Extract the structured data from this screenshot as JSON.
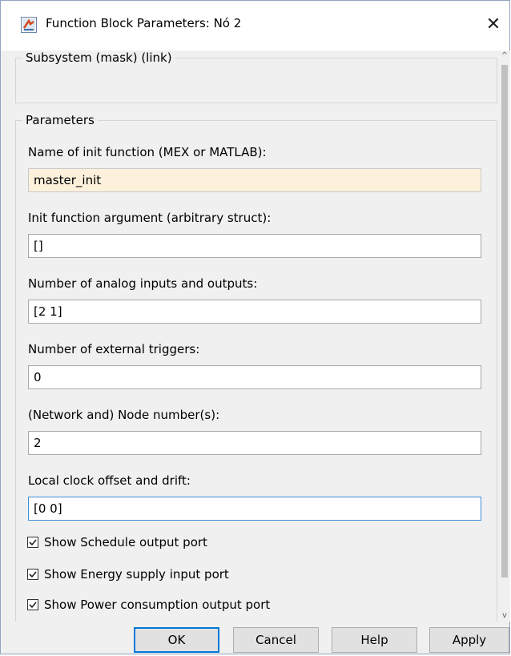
{
  "window": {
    "title": "Function Block Parameters: Nó 2",
    "close_symbol": "✕",
    "icon": "simulink-block-icon"
  },
  "subsystem": {
    "legend": "Subsystem (mask) (link)"
  },
  "parameters": {
    "legend": "Parameters",
    "fields": [
      {
        "label": "Name of init function (MEX or MATLAB):",
        "value": "master_init"
      },
      {
        "label": "Init function argument (arbitrary struct):",
        "value": "[]"
      },
      {
        "label": "Number of analog inputs and outputs:",
        "value": "[2 1]"
      },
      {
        "label": "Number of external triggers:",
        "value": "0"
      },
      {
        "label": "(Network and) Node number(s):",
        "value": "2"
      },
      {
        "label": "Local clock offset and drift:",
        "value": "[0 0]"
      }
    ],
    "checkboxes": [
      {
        "label": "Show Schedule output port",
        "checked": true
      },
      {
        "label": "Show Energy supply input port",
        "checked": true
      },
      {
        "label": "Show Power consumption output port",
        "checked": true
      }
    ]
  },
  "buttons": {
    "ok": "OK",
    "cancel": "Cancel",
    "help": "Help",
    "apply": "Apply"
  },
  "scrollbar": {
    "up": "^",
    "down": "v"
  }
}
